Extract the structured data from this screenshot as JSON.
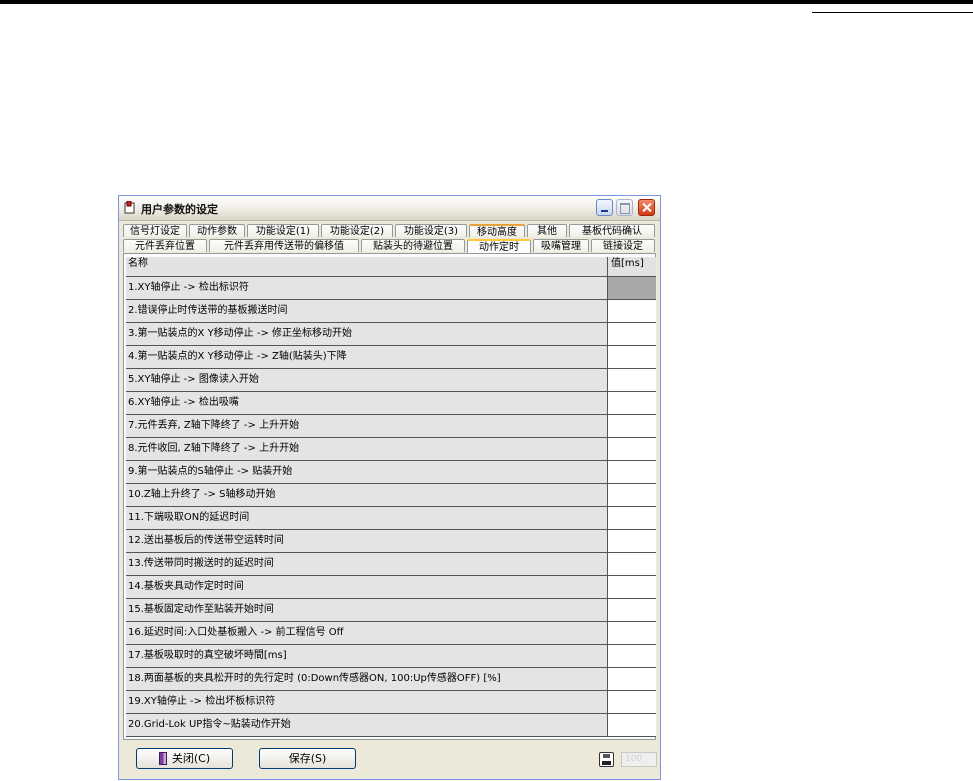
{
  "window": {
    "title": "用户参数的设定"
  },
  "tabs_row1": [
    {
      "label": "信号灯设定"
    },
    {
      "label": "动作参数"
    },
    {
      "label": "功能设定(1)"
    },
    {
      "label": "功能设定(2)"
    },
    {
      "label": "功能设定(3)"
    },
    {
      "label": "移动高度"
    },
    {
      "label": "其他"
    },
    {
      "label": "基板代码确认"
    }
  ],
  "tabs_row2": [
    {
      "label": "元件丢弃位置"
    },
    {
      "label": "元件丢弃用传送带的偏移值"
    },
    {
      "label": "贴装头的待避位置"
    },
    {
      "label": "动作定时"
    },
    {
      "label": "吸嘴管理"
    },
    {
      "label": "链接设定"
    }
  ],
  "table": {
    "header_name": "名称",
    "header_value": "值[ms]",
    "rows": [
      {
        "name": " 1.XY轴停止 -> 检出标识符",
        "value": ""
      },
      {
        "name": " 2.错误停止时传送带的基板搬送时间",
        "value": ""
      },
      {
        "name": " 3.第一贴装点的X Y移动停止 -> 修正坐标移动开始",
        "value": ""
      },
      {
        "name": " 4.第一贴装点的X Y移动停止 -> Z轴(贴装头)下降",
        "value": ""
      },
      {
        "name": " 5.XY轴停止 -> 图像读入开始",
        "value": ""
      },
      {
        "name": " 6.XY轴停止 -> 检出吸嘴",
        "value": ""
      },
      {
        "name": " 7.元件丢弃, Z轴下降终了 -> 上升开始",
        "value": ""
      },
      {
        "name": " 8.元件收回, Z轴下降终了 -> 上升开始",
        "value": ""
      },
      {
        "name": " 9.第一贴装点的S轴停止 -> 贴装开始",
        "value": ""
      },
      {
        "name": "10.Z轴上升终了 -> S轴移动开始",
        "value": ""
      },
      {
        "name": "11.下端吸取ON的延迟时间",
        "value": ""
      },
      {
        "name": "12.送出基板后的传送带空运转时间",
        "value": ""
      },
      {
        "name": "13.传送带同时搬送时的延迟时间",
        "value": ""
      },
      {
        "name": "14.基板夹具动作定时时间",
        "value": ""
      },
      {
        "name": "15.基板固定动作至贴装开始时间",
        "value": ""
      },
      {
        "name": "16.延迟时间:入口处基板搬入 -> 前工程信号 Off",
        "value": ""
      },
      {
        "name": "17.基板吸取时的真空破坏時間[ms]",
        "value": ""
      },
      {
        "name": "18.两面基板的夹具松开时的先行定时 (0:Down传感器ON, 100:Up传感器OFF) [%]",
        "value": ""
      },
      {
        "name": "19.XY轴停止 -> 检出坏板标识符",
        "value": ""
      },
      {
        "name": "20.Grid-Lok UP指令~贴装动作开始",
        "value": ""
      }
    ]
  },
  "buttons": {
    "close_label": "关闭(C)",
    "save_label": "保存(S)"
  },
  "status_box": "100"
}
